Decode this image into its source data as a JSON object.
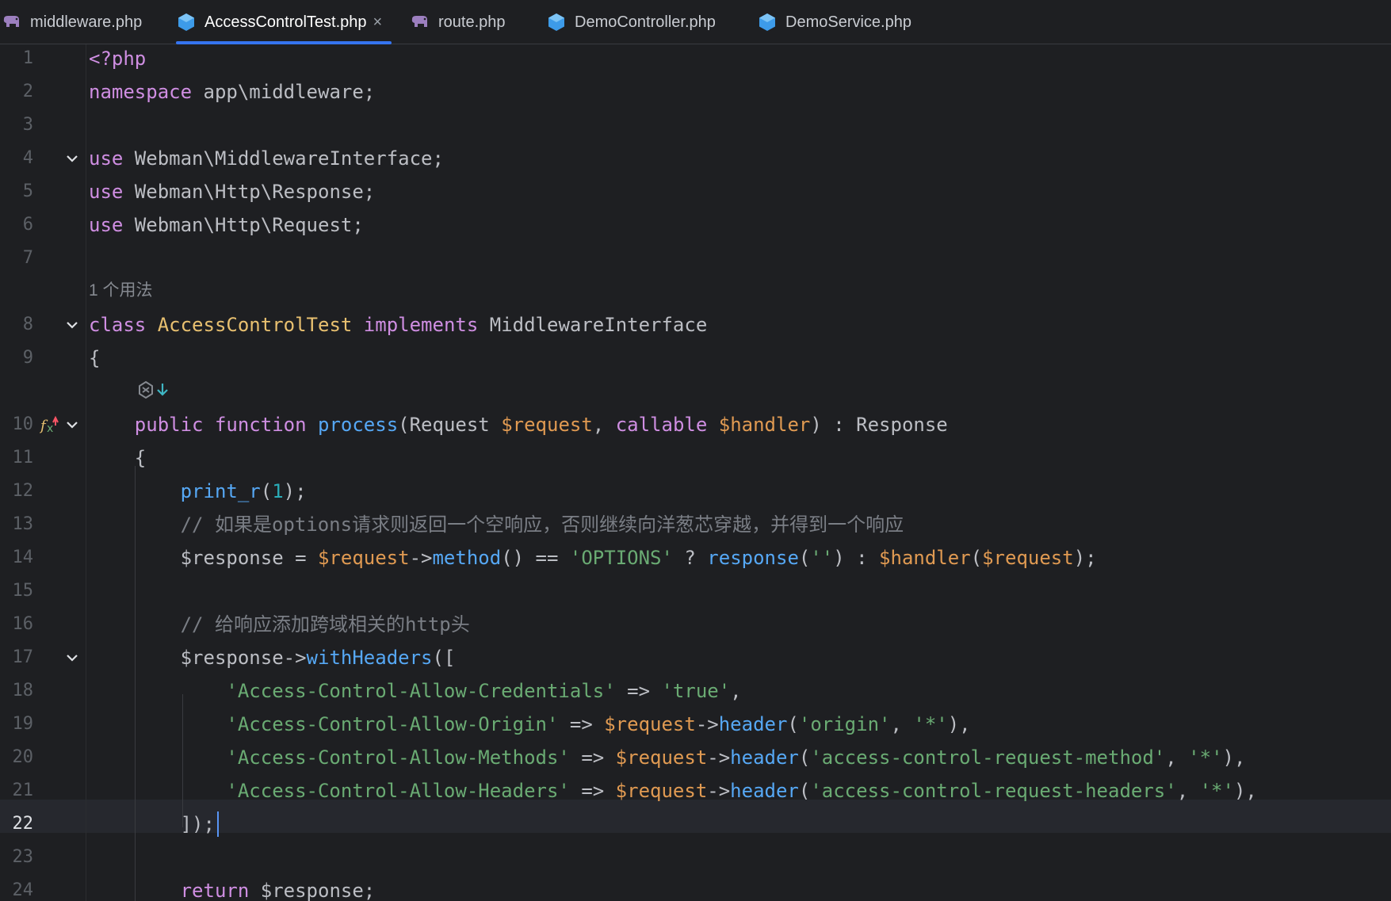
{
  "colors": {
    "background": "#1e1f22",
    "active_tab_underline": "#3574f0",
    "keyword": "#cf8ee2",
    "class_name": "#e8c070",
    "function": "#56a8f5",
    "variable": "#e09a52",
    "string": "#6aab73",
    "number": "#2aacb8",
    "comment": "#7a7e85",
    "caret": "#5895f5"
  },
  "tabs": [
    {
      "label": "middleware.php",
      "icon": "php-elephant-icon",
      "active": false
    },
    {
      "label": "AccessControlTest.php",
      "icon": "php-class-icon",
      "active": true,
      "close": "×"
    },
    {
      "label": "route.php",
      "icon": "php-elephant-icon",
      "active": false
    },
    {
      "label": "DemoController.php",
      "icon": "php-class-icon",
      "active": false
    },
    {
      "label": "DemoService.php",
      "icon": "php-class-icon",
      "active": false
    }
  ],
  "editor": {
    "current_line": "22",
    "usage_hint": "1 个用法",
    "line_numbers": [
      "1",
      "2",
      "3",
      "4",
      "5",
      "6",
      "7",
      "8",
      "9",
      "10",
      "11",
      "12",
      "13",
      "14",
      "15",
      "16",
      "17",
      "18",
      "19",
      "20",
      "21",
      "22",
      "23",
      "24"
    ],
    "lines": [
      [
        {
          "t": "<?php",
          "c": "k-tag"
        }
      ],
      [
        {
          "t": "namespace",
          "c": "k-kw"
        },
        {
          "t": " app\\middleware;",
          "c": "k-plain"
        }
      ],
      [],
      [
        {
          "t": "use",
          "c": "k-kw"
        },
        {
          "t": " Webman\\MiddlewareInterface;",
          "c": "k-plain"
        }
      ],
      [
        {
          "t": "use",
          "c": "k-kw"
        },
        {
          "t": " Webman\\Http\\Response;",
          "c": "k-plain"
        }
      ],
      [
        {
          "t": "use",
          "c": "k-kw"
        },
        {
          "t": " Webman\\Http\\Request;",
          "c": "k-plain"
        }
      ],
      [],
      [
        {
          "t": "class",
          "c": "k-kw"
        },
        {
          "t": " ",
          "c": "k-plain"
        },
        {
          "t": "AccessControlTest",
          "c": "k-cls"
        },
        {
          "t": " ",
          "c": "k-plain"
        },
        {
          "t": "implements",
          "c": "k-kw"
        },
        {
          "t": " MiddlewareInterface",
          "c": "k-plain"
        }
      ],
      [
        {
          "t": "{",
          "c": "k-plain"
        }
      ],
      [
        {
          "t": "    ",
          "c": "k-plain"
        },
        {
          "t": "public",
          "c": "k-kw"
        },
        {
          "t": " ",
          "c": "k-plain"
        },
        {
          "t": "function",
          "c": "k-kw"
        },
        {
          "t": " ",
          "c": "k-plain"
        },
        {
          "t": "process",
          "c": "k-fn"
        },
        {
          "t": "(Request ",
          "c": "k-plain"
        },
        {
          "t": "$request",
          "c": "k-var"
        },
        {
          "t": ", ",
          "c": "k-plain"
        },
        {
          "t": "callable",
          "c": "k-kw"
        },
        {
          "t": " ",
          "c": "k-plain"
        },
        {
          "t": "$handler",
          "c": "k-var"
        },
        {
          "t": ") : Response",
          "c": "k-plain"
        }
      ],
      [
        {
          "t": "    {",
          "c": "k-plain"
        }
      ],
      [
        {
          "t": "        ",
          "c": "k-plain"
        },
        {
          "t": "print_r",
          "c": "k-fn"
        },
        {
          "t": "(",
          "c": "k-plain"
        },
        {
          "t": "1",
          "c": "k-num"
        },
        {
          "t": ");",
          "c": "k-plain"
        }
      ],
      [
        {
          "t": "        // 如果是options请求则返回一个空响应，否则继续向洋葱芯穿越，并得到一个响应",
          "c": "k-cmt"
        }
      ],
      [
        {
          "t": "        $response = ",
          "c": "k-plain"
        },
        {
          "t": "$request",
          "c": "k-var"
        },
        {
          "t": "->",
          "c": "k-plain"
        },
        {
          "t": "method",
          "c": "k-fn"
        },
        {
          "t": "() == ",
          "c": "k-plain"
        },
        {
          "t": "'OPTIONS'",
          "c": "k-str"
        },
        {
          "t": " ? ",
          "c": "k-plain"
        },
        {
          "t": "response",
          "c": "k-fn"
        },
        {
          "t": "(",
          "c": "k-plain"
        },
        {
          "t": "''",
          "c": "k-str"
        },
        {
          "t": ") : ",
          "c": "k-plain"
        },
        {
          "t": "$handler",
          "c": "k-var"
        },
        {
          "t": "(",
          "c": "k-plain"
        },
        {
          "t": "$request",
          "c": "k-var"
        },
        {
          "t": ");",
          "c": "k-plain"
        }
      ],
      [],
      [
        {
          "t": "        // 给响应添加跨域相关的http头",
          "c": "k-cmt"
        }
      ],
      [
        {
          "t": "        $response->",
          "c": "k-plain"
        },
        {
          "t": "withHeaders",
          "c": "k-fn"
        },
        {
          "t": "([",
          "c": "k-plain"
        }
      ],
      [
        {
          "t": "            ",
          "c": "k-plain"
        },
        {
          "t": "'Access-Control-Allow-Credentials'",
          "c": "k-str"
        },
        {
          "t": " => ",
          "c": "k-plain"
        },
        {
          "t": "'true'",
          "c": "k-str"
        },
        {
          "t": ",",
          "c": "k-plain"
        }
      ],
      [
        {
          "t": "            ",
          "c": "k-plain"
        },
        {
          "t": "'Access-Control-Allow-Origin'",
          "c": "k-str"
        },
        {
          "t": " => ",
          "c": "k-plain"
        },
        {
          "t": "$request",
          "c": "k-var"
        },
        {
          "t": "->",
          "c": "k-plain"
        },
        {
          "t": "header",
          "c": "k-fn"
        },
        {
          "t": "(",
          "c": "k-plain"
        },
        {
          "t": "'origin'",
          "c": "k-str"
        },
        {
          "t": ", ",
          "c": "k-plain"
        },
        {
          "t": "'*'",
          "c": "k-str"
        },
        {
          "t": "),",
          "c": "k-plain"
        }
      ],
      [
        {
          "t": "            ",
          "c": "k-plain"
        },
        {
          "t": "'Access-Control-Allow-Methods'",
          "c": "k-str"
        },
        {
          "t": " => ",
          "c": "k-plain"
        },
        {
          "t": "$request",
          "c": "k-var"
        },
        {
          "t": "->",
          "c": "k-plain"
        },
        {
          "t": "header",
          "c": "k-fn"
        },
        {
          "t": "(",
          "c": "k-plain"
        },
        {
          "t": "'access-control-request-method'",
          "c": "k-str"
        },
        {
          "t": ", ",
          "c": "k-plain"
        },
        {
          "t": "'*'",
          "c": "k-str"
        },
        {
          "t": "),",
          "c": "k-plain"
        }
      ],
      [
        {
          "t": "            ",
          "c": "k-plain"
        },
        {
          "t": "'Access-Control-Allow-Headers'",
          "c": "k-str"
        },
        {
          "t": " => ",
          "c": "k-plain"
        },
        {
          "t": "$request",
          "c": "k-var"
        },
        {
          "t": "->",
          "c": "k-plain"
        },
        {
          "t": "header",
          "c": "k-fn"
        },
        {
          "t": "(",
          "c": "k-plain"
        },
        {
          "t": "'access-control-request-headers'",
          "c": "k-str"
        },
        {
          "t": ", ",
          "c": "k-plain"
        },
        {
          "t": "'*'",
          "c": "k-str"
        },
        {
          "t": "),",
          "c": "k-plain"
        }
      ],
      [
        {
          "t": "        ]);",
          "c": "k-plain"
        }
      ],
      [],
      [
        {
          "t": "        ",
          "c": "k-plain"
        },
        {
          "t": "return",
          "c": "k-kw"
        },
        {
          "t": " $response;",
          "c": "k-plain"
        }
      ]
    ]
  }
}
